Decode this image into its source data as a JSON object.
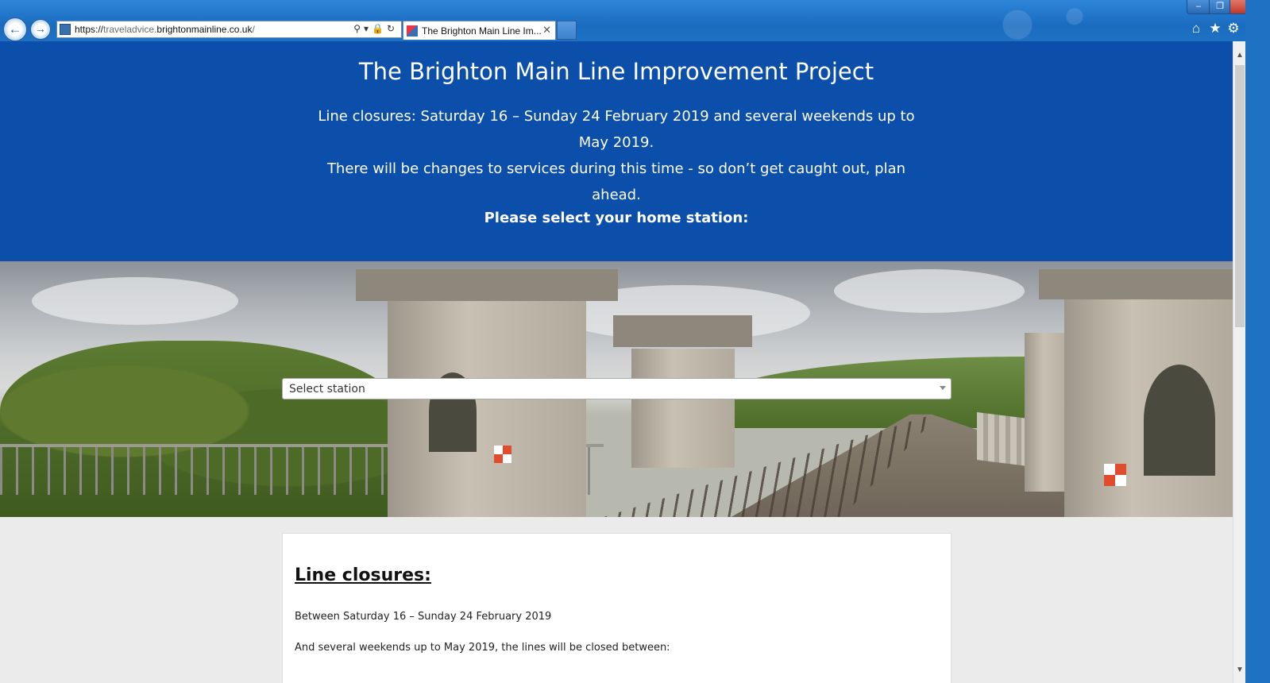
{
  "browser": {
    "url_prefix": "https://",
    "url_sub": "traveladvice.",
    "url_domain": "brightonmainline.co.uk",
    "url_suffix": "/",
    "tab_title": "The Brighton Main Line Im...",
    "tab_close": "✕",
    "window_min": "–",
    "window_max": "❐",
    "window_close": "✕",
    "back": "←",
    "forward": "→",
    "addr_icons": "⚲▾🔒↻",
    "home": "⌂",
    "favorites": "★",
    "tools": "⚙"
  },
  "hero": {
    "title": "The Brighton Main Line Improvement Project",
    "closures_line": "Line closures: Saturday 16 – Sunday 24 February 2019 and several weekends up to May 2019.",
    "changes_line": "There will be changes to services during this time - so don’t get caught out, plan ahead.",
    "prompt": "Please select your home station:"
  },
  "station_select": {
    "selected": "Select station"
  },
  "card": {
    "heading": "Line closures:",
    "para1": "Between Saturday 16 – Sunday 24 February 2019",
    "para2": "And several weekends up to May 2019, the lines will be closed between:"
  },
  "scrollbar": {
    "up": "▲",
    "down": "▼",
    "position": 0.0
  },
  "colors": {
    "hero_bg": "#0b4faa",
    "chrome_bg": "#1f71c4"
  }
}
